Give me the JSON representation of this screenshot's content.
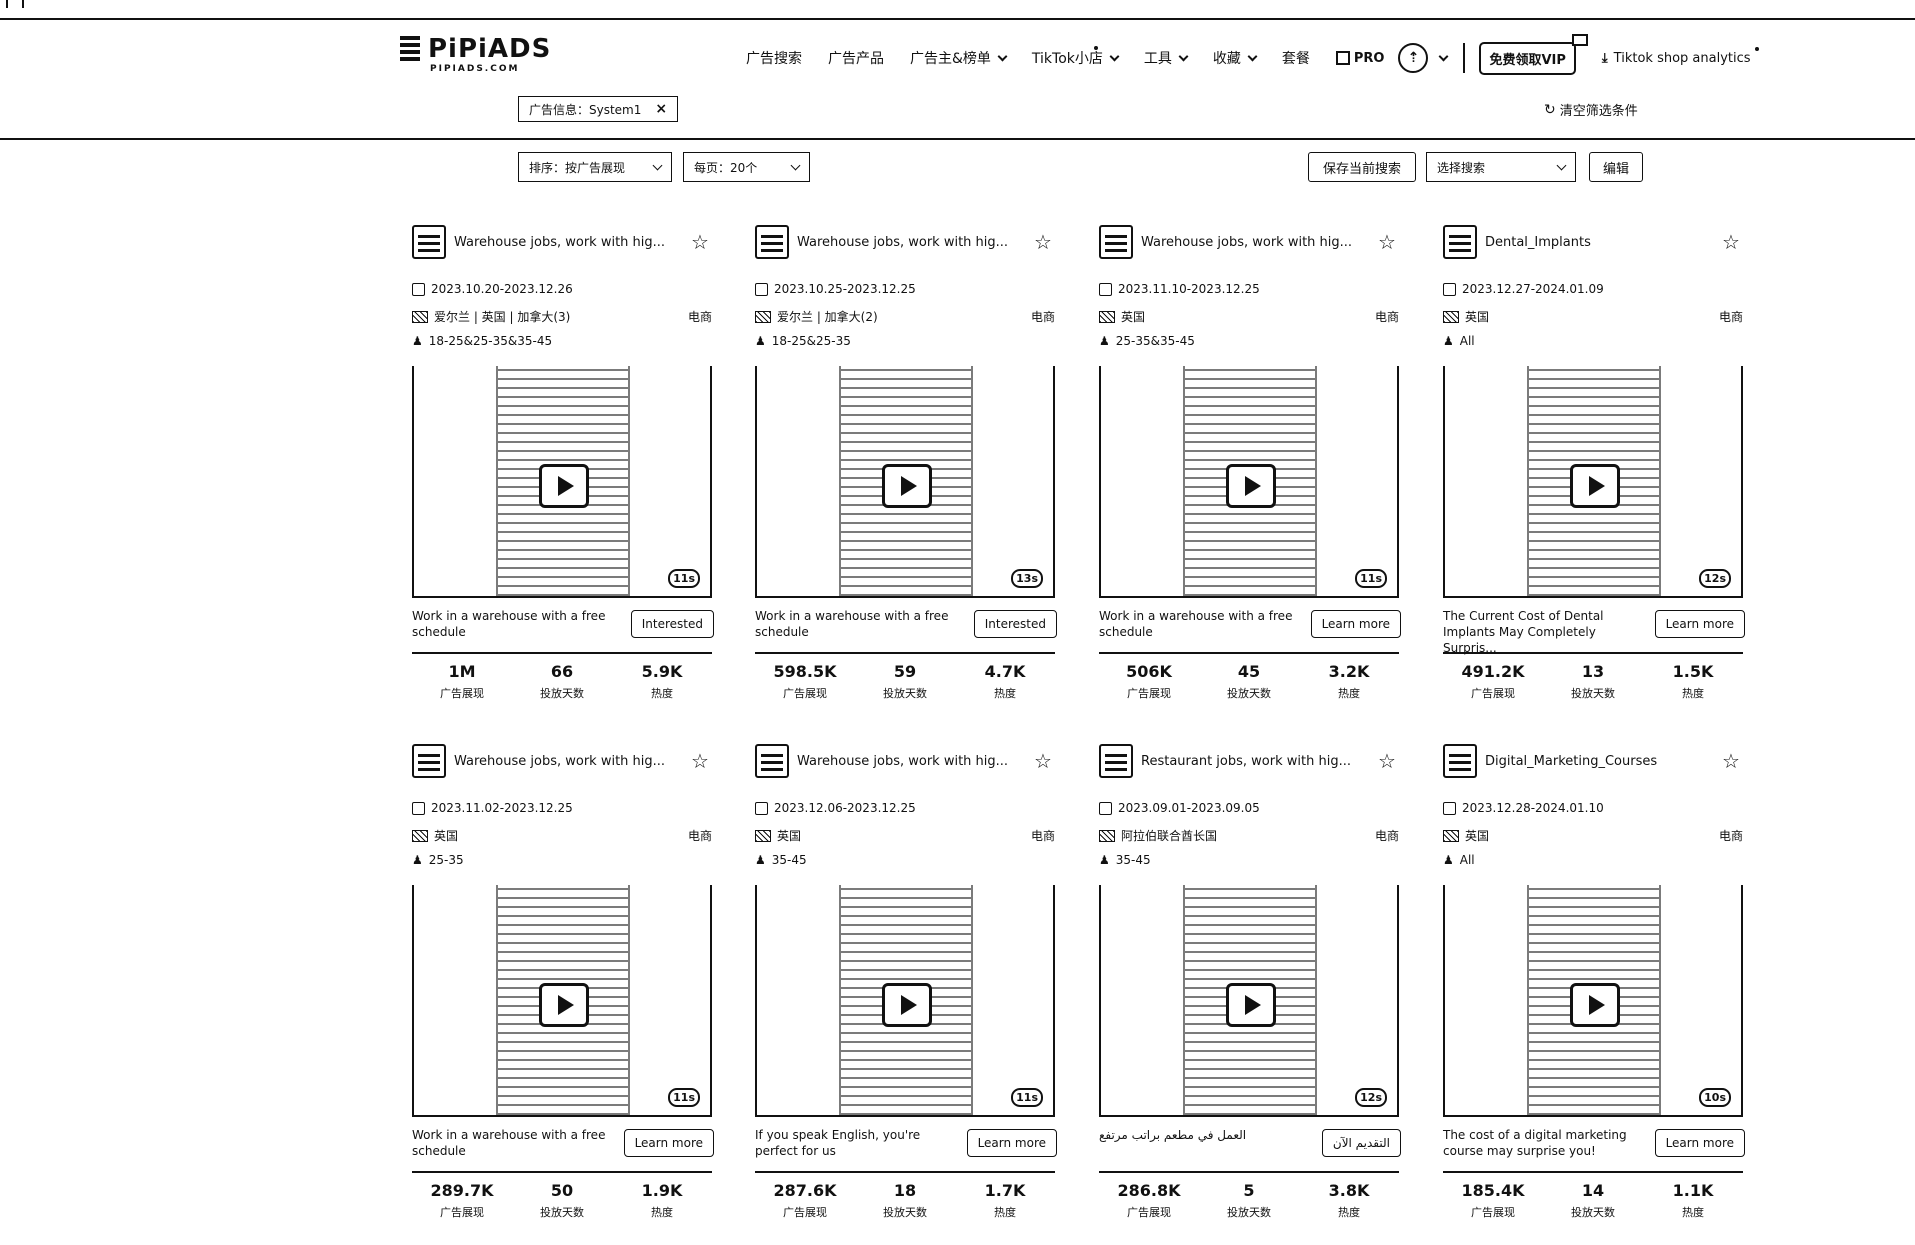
{
  "logo": {
    "word": "PiPiADS",
    "sub": "PIPIADS.COM"
  },
  "nav": {
    "items": [
      {
        "label": "广告搜索",
        "chev": false
      },
      {
        "label": "广告产品",
        "chev": false
      },
      {
        "label": "广告主&榜单",
        "chev": true
      },
      {
        "label": "TikTok小店",
        "chev": true,
        "dot": true
      },
      {
        "label": "工具",
        "chev": true
      },
      {
        "label": "收藏",
        "chev": true
      },
      {
        "label": "套餐",
        "chev": false
      }
    ],
    "pro_label": "PRO",
    "avatar_label": "⇡",
    "vip_label": "免费领取VIP",
    "analytics_label": "Tiktok shop analytics"
  },
  "filter": {
    "chip_label": "广告信息：System1",
    "clear_label": "清空筛选条件"
  },
  "toolbar": {
    "sort_label": "排序：按广告展现",
    "per_page_label": "每页：20个",
    "save_label": "保存当前搜索",
    "choose_label": "选择搜索",
    "edit_label": "编辑"
  },
  "stat_labels": {
    "impressions": "广告展现",
    "days": "投放天数",
    "heat": "热度"
  },
  "cards": [
    {
      "title": "Warehouse jobs, work with hig...",
      "date": "2023.10.20-2023.12.26",
      "region": "爱尔兰 | 英国 | 加拿大(3)",
      "category": "电商",
      "age": "18-25&25-35&35-45",
      "duration": "11s",
      "caption": "Work in a warehouse with a free schedule",
      "cta": "Interested",
      "impressions": "1M",
      "days": "66",
      "heat": "5.9K"
    },
    {
      "title": "Warehouse jobs, work with hig...",
      "date": "2023.10.25-2023.12.25",
      "region": "爱尔兰 | 加拿大(2)",
      "category": "电商",
      "age": "18-25&25-35",
      "duration": "13s",
      "caption": "Work in a warehouse with a free schedule",
      "cta": "Interested",
      "impressions": "598.5K",
      "days": "59",
      "heat": "4.7K"
    },
    {
      "title": "Warehouse jobs, work with hig...",
      "date": "2023.11.10-2023.12.25",
      "region": "英国",
      "category": "电商",
      "age": "25-35&35-45",
      "duration": "11s",
      "caption": "Work in a warehouse with a free schedule",
      "cta": "Learn more",
      "impressions": "506K",
      "days": "45",
      "heat": "3.2K"
    },
    {
      "title": "Dental_Implants",
      "date": "2023.12.27-2024.01.09",
      "region": "英国",
      "category": "电商",
      "age": "All",
      "duration": "12s",
      "caption": "The Current Cost of Dental Implants May Completely Surpris...",
      "cta": "Learn more",
      "impressions": "491.2K",
      "days": "13",
      "heat": "1.5K"
    },
    {
      "title": "Warehouse jobs, work with hig...",
      "date": "2023.11.02-2023.12.25",
      "region": "英国",
      "category": "电商",
      "age": "25-35",
      "duration": "11s",
      "caption": "Work in a warehouse with a free schedule",
      "cta": "Learn more",
      "impressions": "289.7K",
      "days": "50",
      "heat": "1.9K"
    },
    {
      "title": "Warehouse jobs, work with hig...",
      "date": "2023.12.06-2023.12.25",
      "region": "英国",
      "category": "电商",
      "age": "35-45",
      "duration": "11s",
      "caption": "If you speak English, you're perfect for us",
      "cta": "Learn more",
      "impressions": "287.6K",
      "days": "18",
      "heat": "1.7K"
    },
    {
      "title": "Restaurant jobs, work with hig...",
      "date": "2023.09.01-2023.09.05",
      "region": "阿拉伯联合酋长国",
      "category": "电商",
      "age": "35-45",
      "duration": "12s",
      "caption": "العمل في مطعم براتب مرتفع",
      "cta": "التقديم الآن",
      "impressions": "286.8K",
      "days": "5",
      "heat": "3.8K"
    },
    {
      "title": "Digital_Marketing_Courses",
      "date": "2023.12.28-2024.01.10",
      "region": "英国",
      "category": "电商",
      "age": "All",
      "duration": "10s",
      "caption": "The cost of a digital marketing course may surprise you!",
      "cta": "Learn more",
      "impressions": "185.4K",
      "days": "14",
      "heat": "1.1K"
    }
  ]
}
